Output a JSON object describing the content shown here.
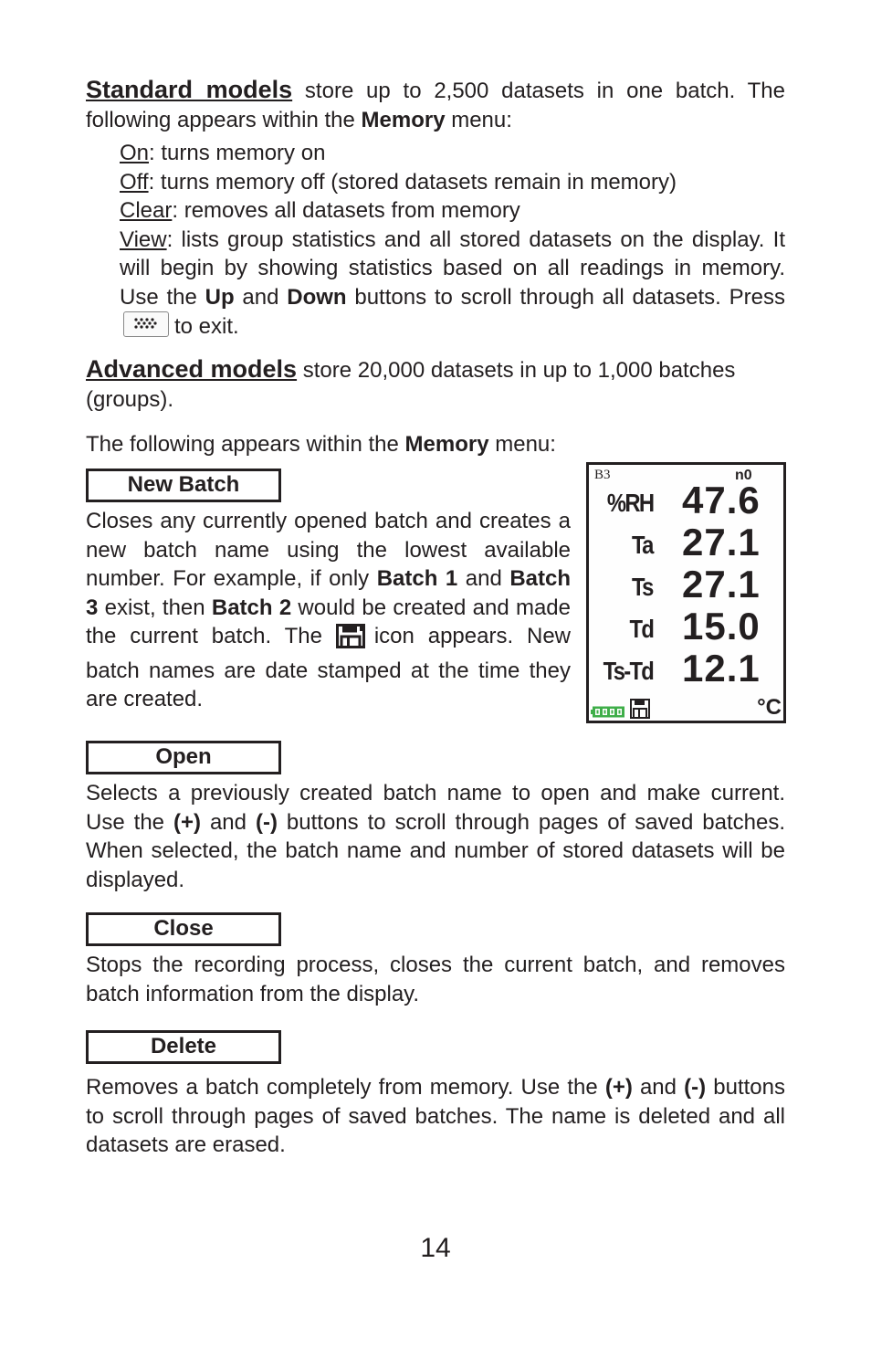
{
  "standard": {
    "heading": "Standard models",
    "intro_rest": " store up to 2,500 datasets in one batch. The following appears within the ",
    "menu_word": "Memory",
    "intro_end": " menu:",
    "items": [
      {
        "term": "On",
        "desc": ": turns memory on"
      },
      {
        "term": "Off",
        "desc": ": turns memory off (stored datasets remain in memory)"
      },
      {
        "term": "Clear",
        "desc": ": removes all datasets from memory"
      }
    ],
    "view": {
      "term": "View",
      "desc_1": ": lists group statistics and all stored datasets on the display. It will begin by showing statistics based on all readings in memory. Use the ",
      "up": "Up",
      "and": " and ",
      "down": "Down",
      "desc_2": " buttons to scroll through all datasets. Press",
      "desc_3": "to exit.",
      "key_icon": "menu-key-icon"
    }
  },
  "advanced": {
    "heading": "Advanced models",
    "intro_rest": " store 20,000 datasets in up to 1,000 batches (groups).",
    "follow": "The following appears within the ",
    "menu_word": "Memory",
    "follow_end": " menu:"
  },
  "new_batch": {
    "label": "New Batch",
    "t1": "Closes any currently opened batch and creates a new batch name using the lowest available number. For example, if only ",
    "b1": "Batch 1",
    "t2": " and ",
    "b2": "Batch 3",
    "t3": " exist, then ",
    "b3": "Batch 2",
    "t4": " would be created and made the current batch. The ",
    "icon": "save-disk-icon",
    "t5": "icon appears. New batch names are date stamped at the time they are created."
  },
  "lcd": {
    "batch": "B3",
    "count": "n0",
    "rows": [
      {
        "label": "%RH",
        "value": "47.6"
      },
      {
        "label": "Ta",
        "value": "27.1"
      },
      {
        "label": "Ts",
        "value": "27.1"
      },
      {
        "label": "Td",
        "value": "15.0"
      },
      {
        "label": "Ts-Td",
        "value": "12.1"
      }
    ],
    "unit": "°C",
    "battery_color": "#3fae49"
  },
  "open": {
    "label": "Open",
    "t1": "Selects a previously created batch  name to open and make current. Use the ",
    "plus": "(+)",
    "and": " and ",
    "minus": "(-)",
    "t2": " buttons to scroll through pages of saved batches. When selected, the batch name and number of stored datasets will be displayed."
  },
  "close": {
    "label": "Close",
    "text": "Stops the recording process, closes the current batch, and removes batch information from the display."
  },
  "delete": {
    "label": "Delete",
    "t1": "Removes a batch completely from memory. Use the ",
    "plus": "(+)",
    "and": " and ",
    "minus": "(-)",
    "t2": " buttons to scroll through pages of saved batches. The name is deleted and all datasets are erased."
  },
  "page_number": "14"
}
